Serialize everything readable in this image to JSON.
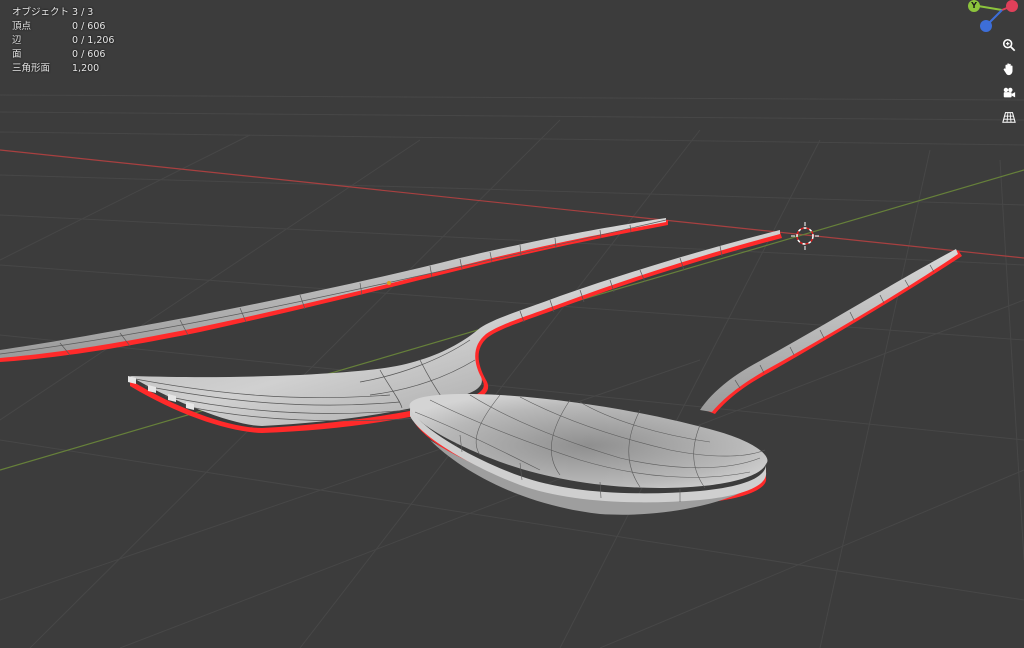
{
  "stats": {
    "objects": {
      "label": "オブジェクト",
      "value": "3 / 3"
    },
    "vertices": {
      "label": "頂点",
      "value": "0 / 606"
    },
    "edges": {
      "label": "辺",
      "value": "0 / 1,206"
    },
    "faces": {
      "label": "面",
      "value": "0 / 606"
    },
    "triangles": {
      "label": "三角形面",
      "value": "1,200"
    }
  },
  "gizmo": {
    "y_axis_label": "Y",
    "y_color": "#8cc43c",
    "x_color": "#e0405a",
    "z_color": "#3d6ed8"
  },
  "tools": [
    {
      "name": "zoom-tool",
      "icon": "zoom-icon"
    },
    {
      "name": "pan-tool",
      "icon": "hand-icon"
    },
    {
      "name": "camera-view-tool",
      "icon": "camera-icon"
    },
    {
      "name": "perspective-toggle",
      "icon": "grid-icon"
    }
  ],
  "colors": {
    "background": "#3c3c3c",
    "grid": "#474747",
    "x_axis": "#b04545",
    "y_axis": "#6f8a3c",
    "outline": "#ff2a2a",
    "mesh": "#bdbdbd"
  }
}
